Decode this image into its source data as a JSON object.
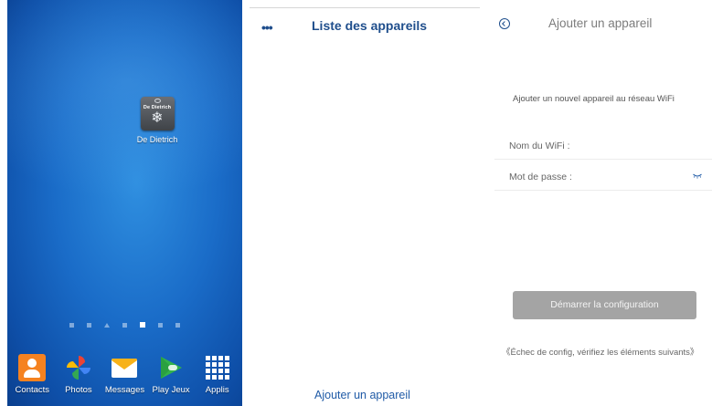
{
  "home_screen": {
    "app_shortcut": {
      "brand_text": "De Dietrich",
      "label": "De Dietrich"
    },
    "dock": [
      {
        "label": "Contacts",
        "icon": "contacts-icon"
      },
      {
        "label": "Photos",
        "icon": "photos-icon"
      },
      {
        "label": "Messages",
        "icon": "messages-icon"
      },
      {
        "label": "Play Jeux",
        "icon": "play-games-icon"
      },
      {
        "label": "Applis",
        "icon": "apps-grid-icon"
      }
    ],
    "page_dots": 7,
    "active_page": 4
  },
  "device_list": {
    "menu_glyph": "•••",
    "title": "Liste des appareils",
    "add_link": "Ajouter un appareil"
  },
  "add_device": {
    "title": "Ajouter un appareil",
    "subtitle": "Ajouter un nouvel appareil au réseau WiFi",
    "wifi_label": "Nom du WiFi :",
    "wifi_value": "",
    "password_label": "Mot de passe :",
    "password_value": "",
    "start_button": "Démarrer la configuration",
    "fail_note": "《Échec de config, vérifiez les éléments suivants》"
  },
  "colors": {
    "accent_blue": "#1f4e8c",
    "button_gray": "#a4a4a4",
    "wallpaper": "#1a6cc8"
  }
}
